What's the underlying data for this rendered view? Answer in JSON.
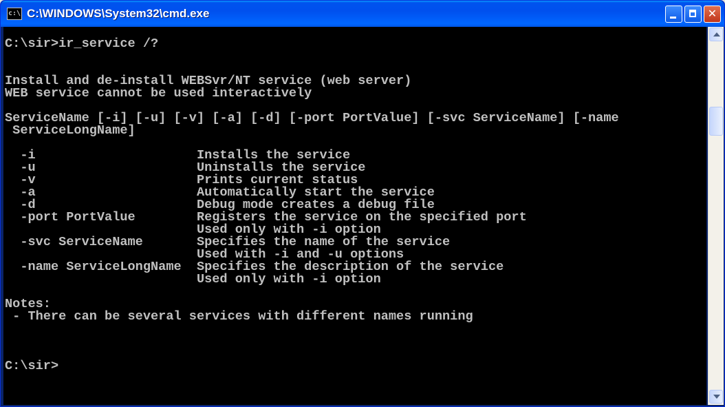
{
  "window": {
    "title": "C:\\WINDOWS\\System32\\cmd.exe",
    "icon_text": "c:\\"
  },
  "console": {
    "text": "C:\\sir>ir_service /?\n\n\nInstall and de-install WEBSvr/NT service (web server)\nWEB service cannot be used interactively\n\nServiceName [-i] [-u] [-v] [-a] [-d] [-port PortValue] [-svc ServiceName] [-name\n ServiceLongName]\n\n  -i                     Installs the service\n  -u                     Uninstalls the service\n  -v                     Prints current status\n  -a                     Automatically start the service\n  -d                     Debug mode creates a debug file\n  -port PortValue        Registers the service on the specified port\n                         Used only with -i option\n  -svc ServiceName       Specifies the name of the service\n                         Used with -i and -u options\n  -name ServiceLongName  Specifies the description of the service\n                         Used only with -i option\n\nNotes:\n - There can be several services with different names running\n\n\n\nC:\\sir>",
    "colors": {
      "background": "#000000",
      "foreground": "#c0c0c0"
    }
  },
  "icons": {
    "app": "console-icon",
    "minimize": "minimize-icon",
    "maximize": "maximize-icon",
    "close": "close-icon",
    "scroll_up": "arrow-up-icon",
    "scroll_down": "arrow-down-icon"
  },
  "buttons": {
    "close_glyph": "✕"
  },
  "scrollbar": {
    "position_fraction": 0.18
  }
}
